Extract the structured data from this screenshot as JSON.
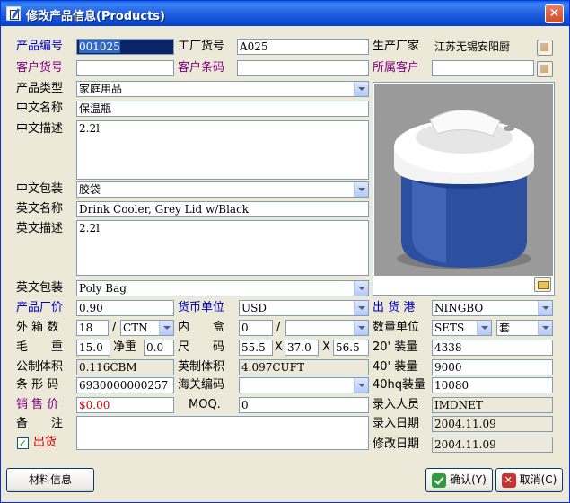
{
  "window": {
    "title": "修改产品信息(Products)",
    "close": "✕"
  },
  "labels": {
    "product_no": "产品编号",
    "factory_no": "工厂货号",
    "manufacturer": "生产厂家",
    "customer_no": "客户货号",
    "customer_barcode": "客户条码",
    "customer": "所属客户",
    "category": "产品类型",
    "cn_name": "中文名称",
    "cn_desc": "中文描述",
    "cn_pack": "中文包装",
    "en_name": "英文名称",
    "en_desc": "英文描述",
    "en_pack": "英文包装",
    "factory_price": "产品厂价",
    "currency": "货币单位",
    "port": "出 货 港",
    "outer_qty": "外 箱 数",
    "slash1": "/",
    "inner_box": "内　　盒",
    "slash2": "/",
    "qty_unit": "数量单位",
    "gross_weight": "毛　　重",
    "net_weight": "净重",
    "size": "尺　　码",
    "x1": "X",
    "x2": "X",
    "load20": "20' 装量",
    "load40": "40' 装量",
    "load40hq": "40hq装量",
    "metric_volume": "公制体积",
    "imperial_volume": "英制体积",
    "barcode": "条 形 码",
    "hs_code": "海关编码",
    "sale_price": "销 售 价",
    "moq": "MOQ.",
    "remark": "备　　注",
    "shipped": "出货",
    "entry_user": "录入人员",
    "entry_date": "录入日期",
    "modify_date": "修改日期"
  },
  "values": {
    "product_no": "001025",
    "factory_no": "A025",
    "manufacturer": "江苏无锡安阳厨",
    "customer_no": "",
    "customer_barcode": "",
    "customer": "",
    "category": "家庭用品",
    "cn_name": "保温瓶",
    "cn_desc": "2.2l",
    "cn_pack": "胶袋",
    "en_name": "Drink Cooler, Grey Lid w/Black",
    "en_desc": "2.2l",
    "en_pack": "Poly Bag",
    "factory_price": "0.90",
    "currency": "USD",
    "port": "NINGBO",
    "outer_qty": "18",
    "outer_unit": "CTN",
    "inner_box": "0",
    "inner_unit": "",
    "qty_unit": "SETS",
    "qty_unit2": "套",
    "gross_weight": "15.0",
    "net_weight": "0.0",
    "size_l": "55.5",
    "size_w": "37.0",
    "size_h": "56.5",
    "load20": "4338",
    "load40": "9000",
    "load40hq": "10080",
    "metric_volume": "0.116CBM",
    "imperial_volume": "4.097CUFT",
    "barcode": "6930000000257",
    "hs_code": "",
    "sale_price": "$0.00",
    "moq": "0",
    "remark": "",
    "shipped": "✓",
    "entry_user": "IMDNET",
    "entry_date": "2004.11.09",
    "modify_date": "2004.11.09"
  },
  "buttons": {
    "material": "材料信息",
    "ok": "确认(Y)",
    "cancel": "取消(C)"
  },
  "icons": {
    "window": "edit-document-icon",
    "manufacturer_pick": "lookup-icon",
    "customer_pick": "lookup-icon",
    "image_open": "folder-icon",
    "ok": "checkmark-shield-icon",
    "cancel": "cancel-shield-icon"
  },
  "colors": {
    "title_bar": "#0a5ce8",
    "label_blue": "#0000cc",
    "label_purple": "#800080",
    "label_red": "#cc0000",
    "window_bg": "#ece9d8"
  }
}
